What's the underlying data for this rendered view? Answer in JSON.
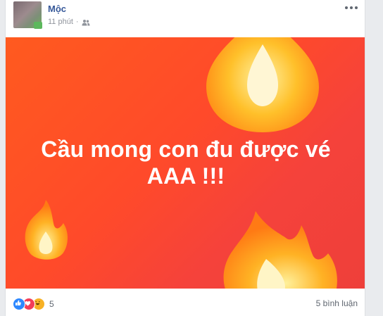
{
  "post": {
    "author": "Mộc",
    "time": "11 phút",
    "audience_icon": "friends-icon",
    "image_text_line1": "Cầu mong con đu được vé",
    "image_text_line2": "AAA !!!",
    "background_color": "#ff4a2a"
  },
  "footer": {
    "reaction_icons": [
      "like-icon",
      "love-icon",
      "haha-icon"
    ],
    "reaction_count": "5",
    "comments": "5 bình luận"
  }
}
